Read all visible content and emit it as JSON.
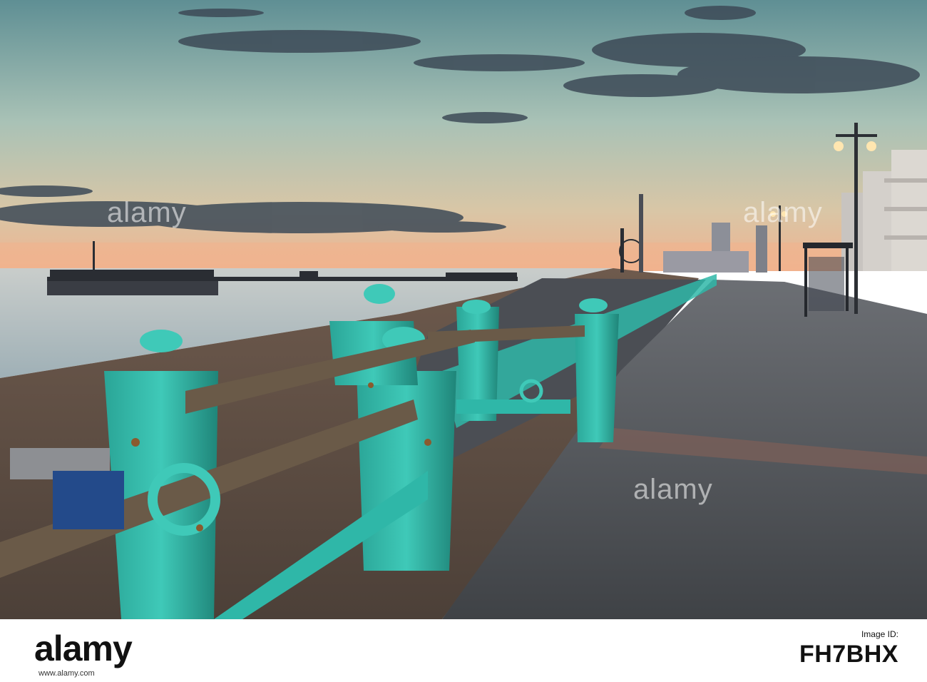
{
  "photo": {
    "subject": "seafront promenade at dusk with pier",
    "colors": {
      "sky_top": "#5f8f94",
      "sky_mid": "#a9c2b6",
      "sky_horizon": "#f0b28f",
      "sea": "#b9c4c8",
      "beach": "#5d4f46",
      "promenade": "#55585d",
      "railing": "#2fb7a8",
      "railing_shadow": "#1e7f76",
      "rust": "#8a5a2e",
      "cloud": "#3d4a57"
    },
    "watermarks": [
      "alamy",
      "alamy",
      "alamy"
    ]
  },
  "footer": {
    "logo": "alamy",
    "id_label": "Image ID:",
    "id_value": "FH7BHX",
    "url": "www.alamy.com"
  }
}
